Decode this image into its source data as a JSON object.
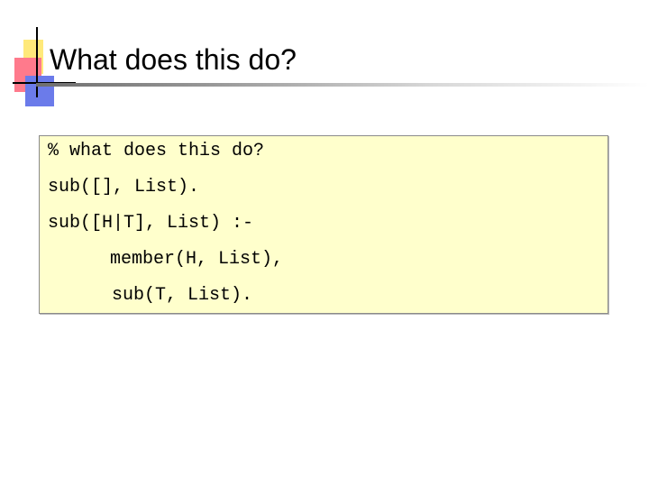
{
  "slide": {
    "title": "What does this do?"
  },
  "code": {
    "lines": [
      "% what does this do?",
      "sub([], List).",
      "sub([H|T], List) :-",
      "member(H, List),",
      "sub(T, List)."
    ]
  },
  "colors": {
    "code_background": "#ffffcc",
    "emblem_yellow": "#ffe97a",
    "emblem_red": "#ff7a8c",
    "emblem_blue": "#6b7bea"
  },
  "icons": {
    "corner_emblem": "decorative-squares-icon"
  }
}
